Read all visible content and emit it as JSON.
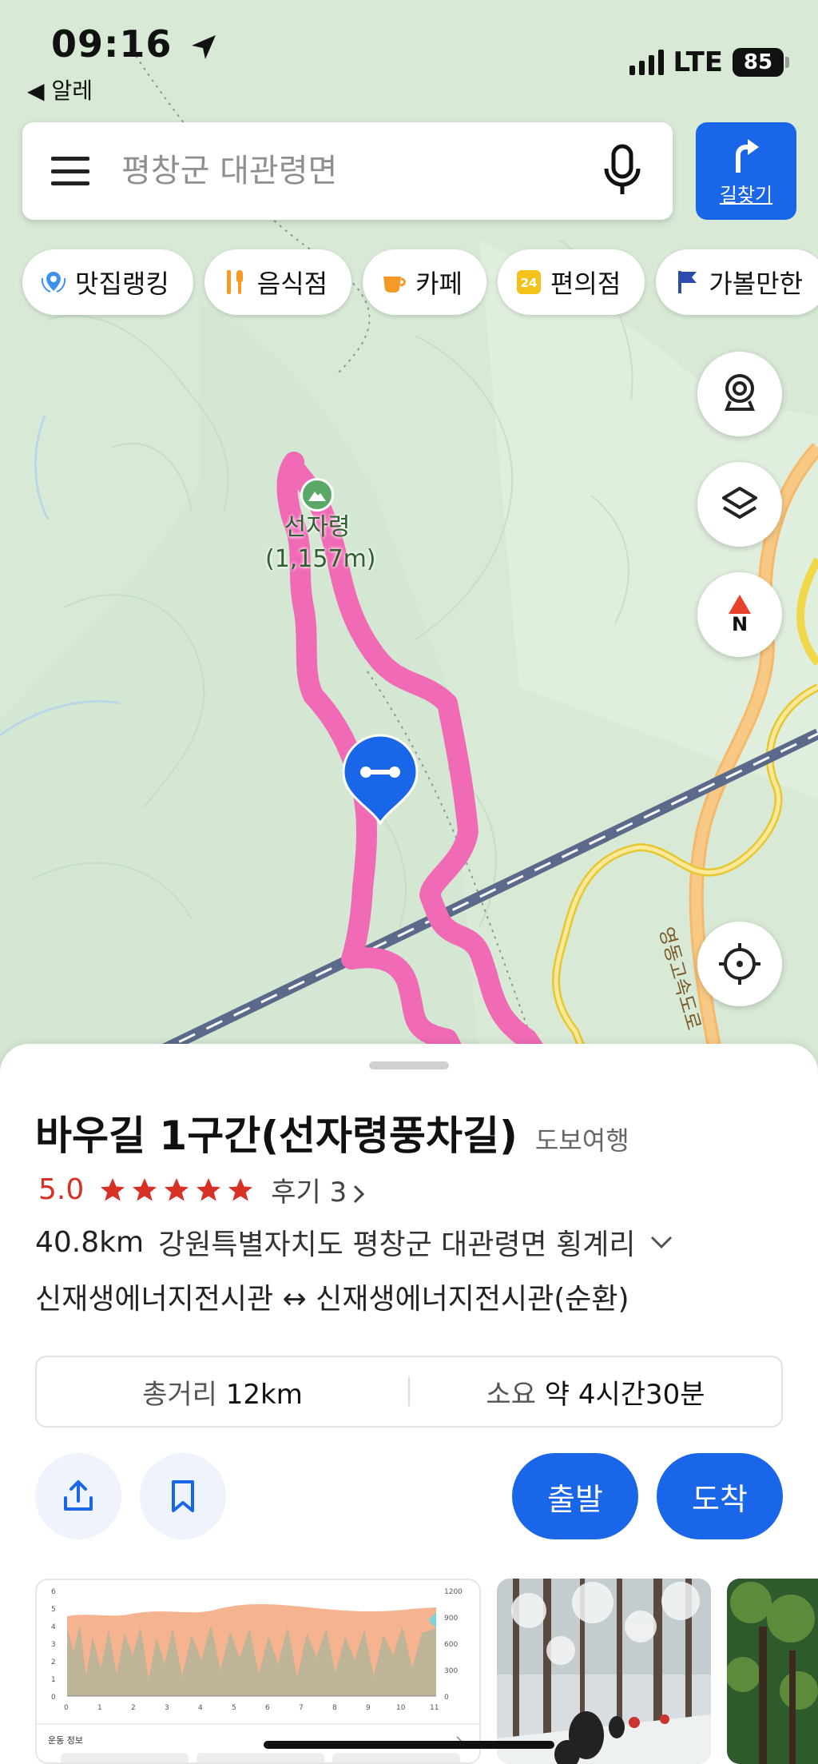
{
  "status": {
    "time": "09:16",
    "back_label": "◀ 알레",
    "network": "LTE",
    "battery": "85"
  },
  "search": {
    "placeholder": "평창군 대관령면",
    "directions_label": "길찾기"
  },
  "chips": [
    {
      "label": "맛집랭킹",
      "icon": "pin-laurel-icon"
    },
    {
      "label": "음식점",
      "icon": "utensils-icon"
    },
    {
      "label": "카페",
      "icon": "coffee-cup-icon"
    },
    {
      "label": "편의점",
      "icon": "convenience-24-icon"
    },
    {
      "label": "가볼만한",
      "icon": "flag-icon"
    }
  ],
  "map": {
    "peak_name": "선자령",
    "peak_elevation": "(1,157m)",
    "road_label": "영동고속도로",
    "compass_label": "N"
  },
  "place": {
    "title": "바우길 1구간(선자령풍차길)",
    "category": "도보여행",
    "rating": "5.0",
    "stars": 5,
    "reviews_label": "후기 3",
    "distance": "40.8km",
    "address": "강원특별자치도 평창군 대관령면 횡계리",
    "route": "신재생에너지전시관 ↔ 신재생에너지전시관(순환)",
    "total_distance_label": "총거리",
    "total_distance_value": "12km",
    "duration_label": "소요",
    "duration_value": "약 4시간30분",
    "depart_label": "출발",
    "arrive_label": "도착"
  },
  "elevation_chart": {
    "y_left_ticks": [
      "6",
      "5",
      "4",
      "3",
      "2",
      "1",
      "0"
    ],
    "y_right_ticks": [
      "1200",
      "900",
      "600",
      "300",
      "0"
    ],
    "x_ticks": [
      "0",
      "1",
      "2",
      "3",
      "4",
      "5",
      "6",
      "7",
      "8",
      "9",
      "10",
      "11"
    ],
    "section_label": "운동 정보"
  },
  "colors": {
    "accent": "#1a66e8",
    "route": "#ef5fb1",
    "rating": "#d93025"
  }
}
